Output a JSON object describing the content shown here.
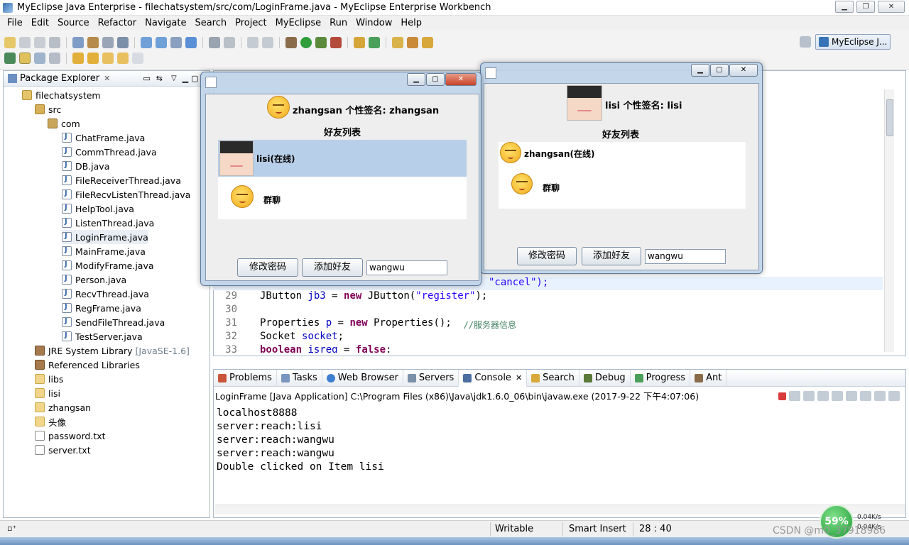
{
  "window": {
    "title": "MyEclipse Java Enterprise - filechatsystem/src/com/LoginFrame.java - MyEclipse Enterprise Workbench"
  },
  "menu": [
    "File",
    "Edit",
    "Source",
    "Refactor",
    "Navigate",
    "Search",
    "Project",
    "MyEclipse",
    "Run",
    "Window",
    "Help"
  ],
  "perspective": "MyEclipse J...",
  "package_explorer": {
    "tab": "Package Explorer",
    "project": "filechatsystem",
    "src": "src",
    "package": "com",
    "files": [
      "ChatFrame.java",
      "CommThread.java",
      "DB.java",
      "FileReceiverThread.java",
      "FileRecvListenThread.java",
      "HelpTool.java",
      "ListenThread.java",
      "LoginFrame.java",
      "MainFrame.java",
      "ModifyFrame.java",
      "Person.java",
      "RecvThread.java",
      "RegFrame.java",
      "SendFileThread.java",
      "TestServer.java"
    ],
    "jre": "JRE System Library",
    "jre_version": "[JavaSE-1.6]",
    "ref_libs": "Referenced Libraries",
    "folders": [
      "libs",
      "lisi",
      "zhangsan",
      "头像"
    ],
    "other_files": [
      "password.txt",
      "server.txt"
    ]
  },
  "editor": {
    "lines": [
      {
        "n": "29",
        "a": "JButton ",
        "b": "jb3",
        "c": " = ",
        "d": "new",
        "e": " JButton(",
        "f": "\"register\"",
        "g": ");"
      },
      {
        "n": "30"
      },
      {
        "n": "31",
        "a": "Properties ",
        "b": "p",
        "c": " = ",
        "d": "new",
        "e": " Properties();  ",
        "f": "//服务器信息"
      },
      {
        "n": "32",
        "a": "Socket ",
        "b": "socket",
        "c": ";"
      },
      {
        "n": "33",
        "a": "boolean",
        "b": " isreg",
        "c": " = ",
        "d": "false",
        "e": ";"
      }
    ],
    "partial_line": "\"cancel\");"
  },
  "console": {
    "tabs": [
      "Problems",
      "Tasks",
      "Web Browser",
      "Servers",
      "Console",
      "Search",
      "Debug",
      "Progress",
      "Ant"
    ],
    "header": "LoginFrame [Java Application] C:\\Program Files (x86)\\Java\\jdk1.6.0_06\\bin\\javaw.exe (2017-9-22 下午4:07:06)",
    "output": [
      "localhost8888",
      "server:reach:lisi",
      "server:reach:wangwu",
      "server:reach:wangwu",
      "Double clicked on Item lisi"
    ]
  },
  "status": {
    "writable": "Writable",
    "insert": "Smart Insert",
    "position": "28 : 40"
  },
  "speed": {
    "percent": "59%",
    "up": "0.04K/s",
    "down": "0.04K/s"
  },
  "watermark": "CSDN @m0_37918986",
  "frame1": {
    "header": "zhangsan 个性签名: zhangsan",
    "list_title": "好友列表",
    "items": [
      "lisi(在线)",
      "群聊"
    ],
    "btn_pwd": "修改密码",
    "btn_add": "添加好友",
    "input": "wangwu"
  },
  "frame2": {
    "header": "lisi 个性签名: lisi",
    "list_title": "好友列表",
    "items": [
      "zhangsan(在线)",
      "群聊"
    ],
    "btn_pwd": "修改密码",
    "btn_add": "添加好友",
    "input": "wangwu"
  }
}
